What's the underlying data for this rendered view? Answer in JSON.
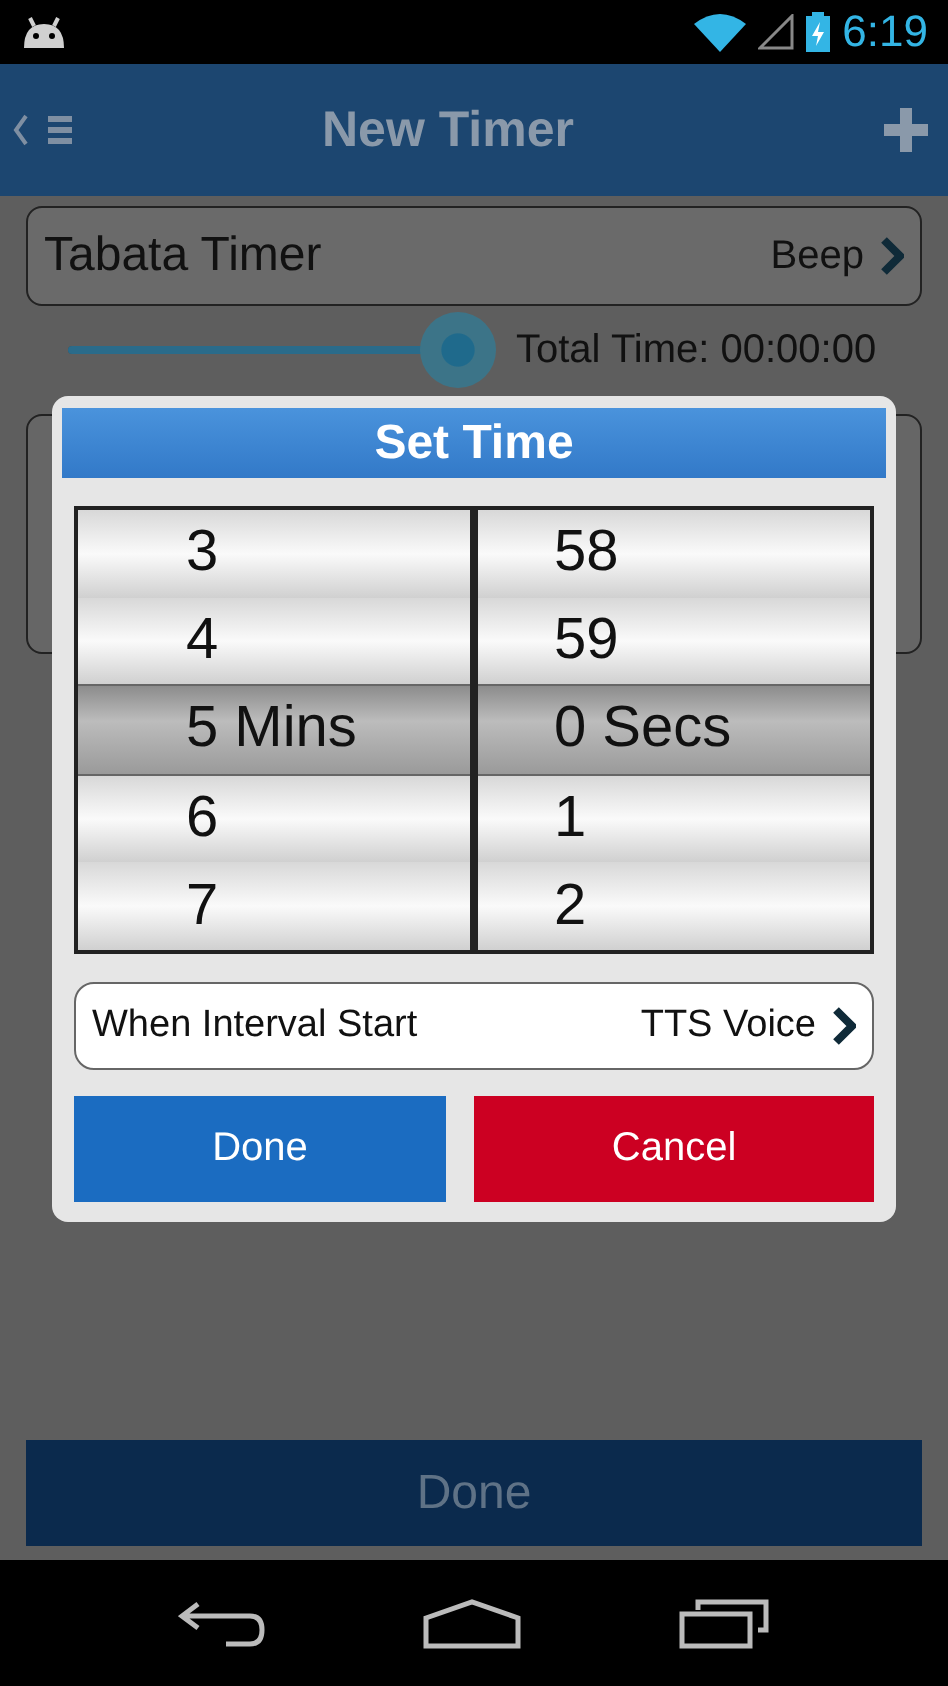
{
  "status_bar": {
    "time": "6:19"
  },
  "app_bar": {
    "title": "New Timer"
  },
  "timer": {
    "name": "Tabata Timer",
    "sound": "Beep",
    "slider": {
      "level": 0.95
    },
    "total_time": "Total Time: 00:00:00"
  },
  "dialog": {
    "title": "Set Time",
    "columns": [
      {
        "items": [
          {
            "label": "3",
            "selected": false
          },
          {
            "label": "4",
            "selected": false
          },
          {
            "label": "5 Mins",
            "selected": true
          },
          {
            "label": "6",
            "selected": false
          },
          {
            "label": "7",
            "selected": false
          }
        ]
      },
      {
        "items": [
          {
            "label": "58",
            "selected": false
          },
          {
            "label": "59",
            "selected": false
          },
          {
            "label": "0 Secs",
            "selected": true
          },
          {
            "label": "1",
            "selected": false
          },
          {
            "label": "2",
            "selected": false
          }
        ]
      }
    ],
    "interval_row": {
      "label": "When Interval Start",
      "value": "TTS Voice"
    },
    "buttons": [
      {
        "label": "Done",
        "kind": "primary"
      },
      {
        "label": "Cancel",
        "kind": "danger"
      }
    ]
  },
  "bottom_button": {
    "label": "Done"
  }
}
